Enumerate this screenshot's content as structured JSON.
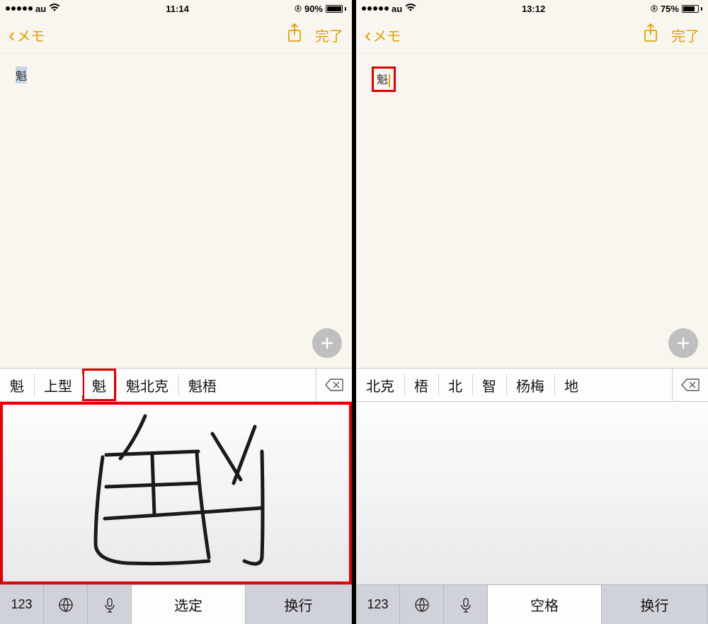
{
  "left": {
    "status": {
      "carrier": "au",
      "time": "11:14",
      "battery_pct": "90%",
      "battery_fill": 90
    },
    "nav": {
      "back_label": "メモ",
      "done_label": "完了"
    },
    "note_text": "魁",
    "candidates": [
      "魁",
      "上型",
      "魁",
      "魁北克",
      "魁梧"
    ],
    "highlight_candidate_index": 2,
    "kb": {
      "numbers": "123",
      "confirm": "选定",
      "enter": "换行"
    }
  },
  "right": {
    "status": {
      "carrier": "au",
      "time": "13:12",
      "battery_pct": "75%",
      "battery_fill": 75
    },
    "nav": {
      "back_label": "メモ",
      "done_label": "完了"
    },
    "note_text": "魁",
    "candidates": [
      "北克",
      "梧",
      "北",
      "智",
      "杨梅",
      "地"
    ],
    "kb": {
      "numbers": "123",
      "confirm": "空格",
      "enter": "换行"
    }
  }
}
